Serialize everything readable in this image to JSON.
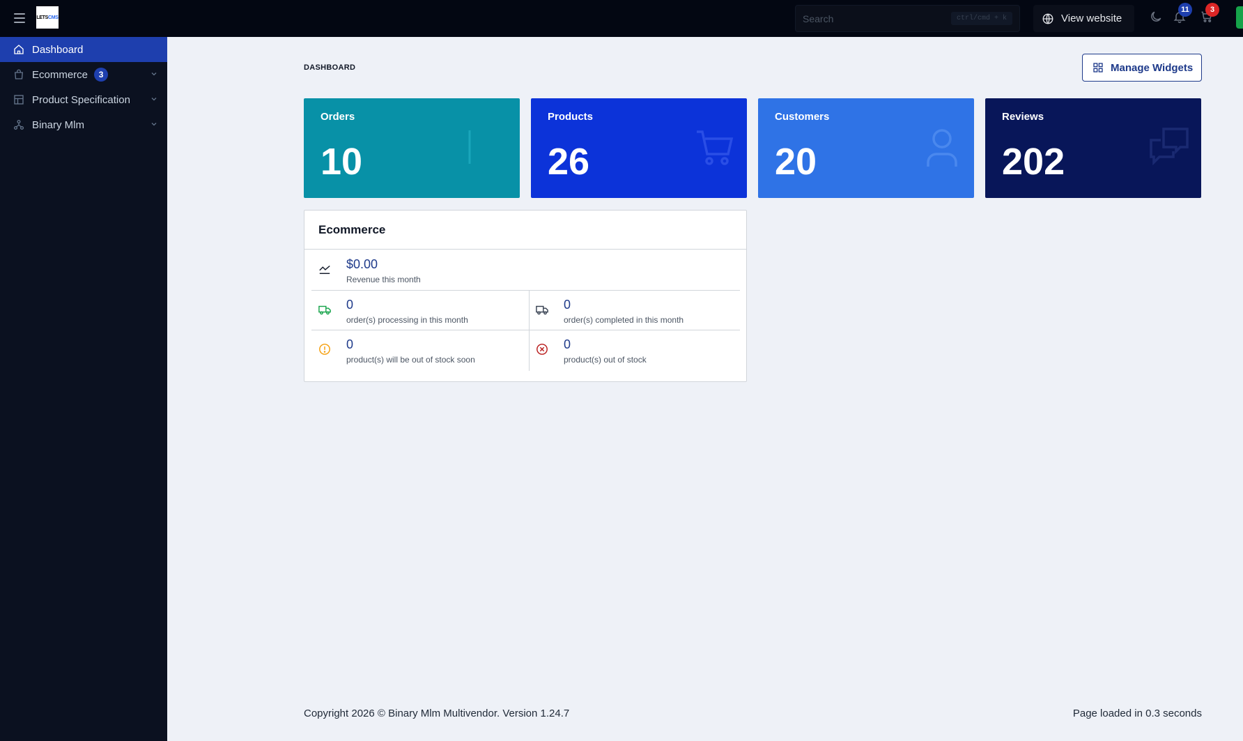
{
  "app": {
    "logo_text_left": "LETS",
    "logo_text_right": "CMS"
  },
  "topbar": {
    "search_placeholder": "Search",
    "search_shortcut": "ctrl/cmd + k",
    "view_website_label": "View website",
    "notifications_count": "11",
    "cart_count": "3"
  },
  "sidebar": {
    "items": [
      {
        "label": "Dashboard",
        "icon": "home-icon",
        "active": true
      },
      {
        "label": "Ecommerce",
        "icon": "shopping-bag-icon",
        "badge": "3"
      },
      {
        "label": "Product Specification",
        "icon": "table-icon"
      },
      {
        "label": "Binary Mlm",
        "icon": "network-icon"
      }
    ]
  },
  "main": {
    "page_title": "DASHBOARD",
    "manage_widgets_label": "Manage Widgets",
    "stats": [
      {
        "label": "Orders",
        "value": "10",
        "color": "#0891a7"
      },
      {
        "label": "Products",
        "value": "26",
        "color": "#0c33d9"
      },
      {
        "label": "Customers",
        "value": "20",
        "color": "#2f73e6"
      },
      {
        "label": "Reviews",
        "value": "202",
        "color": "#081659"
      }
    ],
    "ecommerce": {
      "title": "Ecommerce",
      "revenue": {
        "value": "$0.00",
        "label": "Revenue this month"
      },
      "processing": {
        "value": "0",
        "label": "order(s) processing in this month"
      },
      "completed": {
        "value": "0",
        "label": "order(s) completed in this month"
      },
      "low_stock": {
        "value": "0",
        "label": "product(s) will be out of stock soon"
      },
      "out_of_stock": {
        "value": "0",
        "label": "product(s) out of stock"
      }
    }
  },
  "footer": {
    "copyright": "Copyright 2026 © Binary Mlm Multivendor. Version 1.24.7",
    "load_time": "Page loaded in 0.3 seconds"
  },
  "colors": {
    "topbar_bg": "#030712",
    "sidebar_bg": "#0b1120",
    "active_nav": "#1e3fae",
    "notification_badge": "#1e3fae",
    "cart_badge": "#dc2626"
  }
}
